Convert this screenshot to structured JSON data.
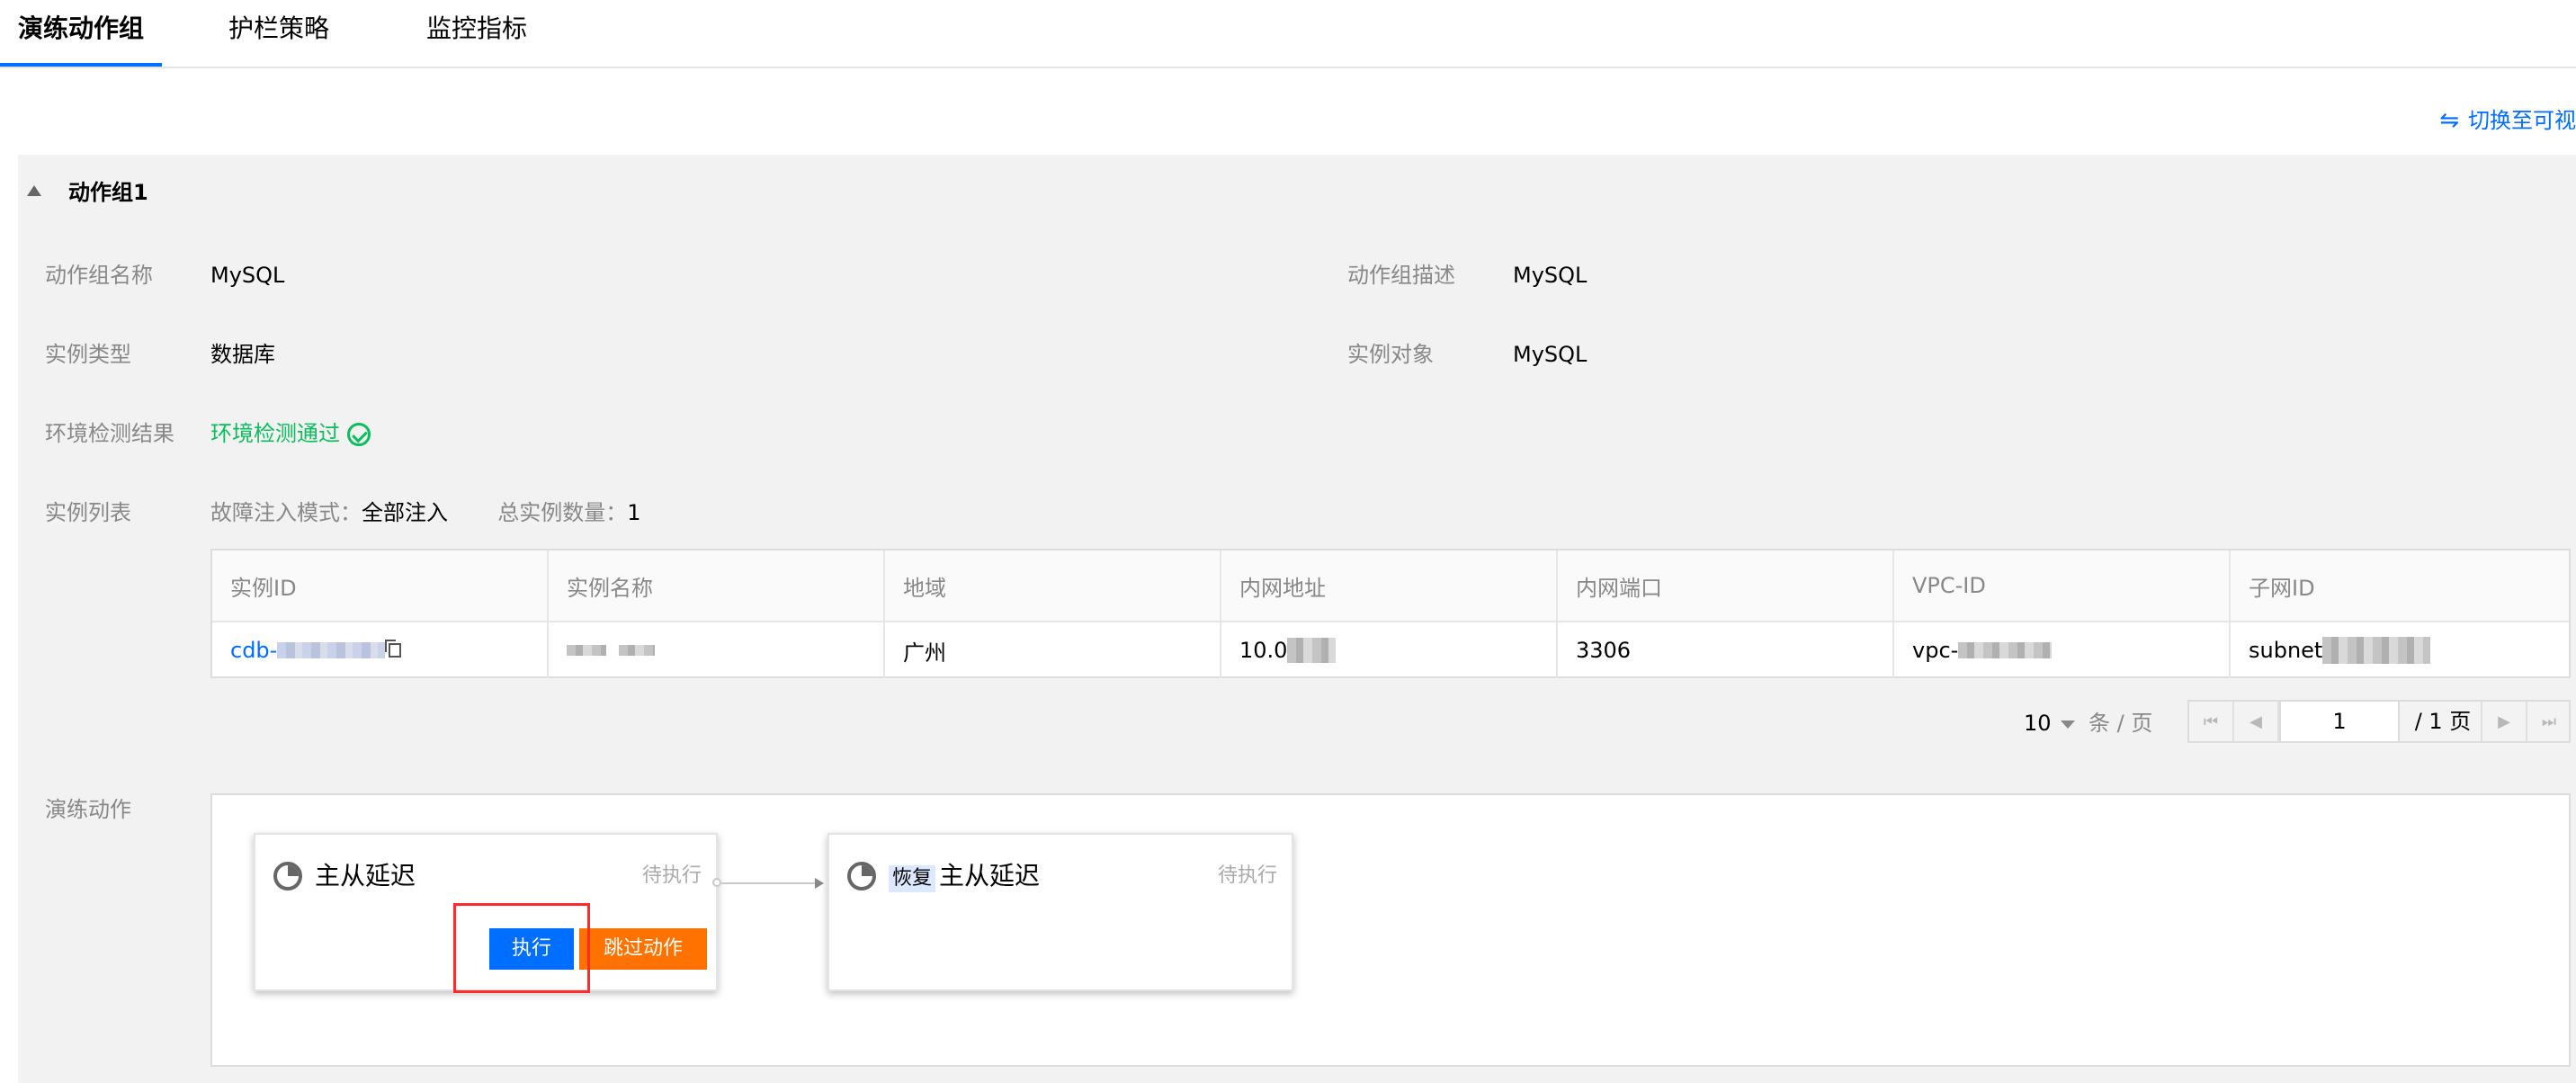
{
  "tabs": [
    {
      "label": "演练动作组",
      "active": true
    },
    {
      "label": "护栏策略",
      "active": false
    },
    {
      "label": "监控指标",
      "active": false
    }
  ],
  "switch_view": {
    "label": "切换至可视"
  },
  "group": {
    "title": "动作组1",
    "fields": {
      "name_label": "动作组名称",
      "name_value": "MySQL",
      "desc_label": "动作组描述",
      "desc_value": "MySQL",
      "type_label": "实例类型",
      "type_value": "数据库",
      "target_label": "实例对象",
      "target_value": "MySQL",
      "env_label": "环境检测结果",
      "env_value": "环境检测通过",
      "instances_label": "实例列表"
    },
    "inject_mode_label": "故障注入模式：",
    "inject_mode_value": "全部注入",
    "total_label": "总实例数量：",
    "total_value": "1"
  },
  "table": {
    "columns": [
      "实例ID",
      "实例名称",
      "地域",
      "内网地址",
      "内网端口",
      "VPC-ID",
      "子网ID"
    ],
    "rows": [
      {
        "id_prefix": "cdb-",
        "region": "广州",
        "ip_prefix": "10.0",
        "port": "3306",
        "vpc_prefix": "vpc-",
        "subnet_prefix": "subnet"
      }
    ]
  },
  "pagination": {
    "page_size": "10",
    "unit": "条 / 页",
    "current": "1",
    "total": "/ 1 页"
  },
  "actions": {
    "label": "演练动作",
    "cards": [
      {
        "title": "主从延迟",
        "status": "待执行",
        "execute_label": "执行",
        "skip_label": "跳过动作"
      },
      {
        "tag": "恢复",
        "title": "主从延迟",
        "status": "待执行"
      }
    ]
  },
  "colors": {
    "primary": "#006eff",
    "success": "#0abf5b",
    "warning": "#ff7200",
    "highlight": "#ff2a2a"
  }
}
